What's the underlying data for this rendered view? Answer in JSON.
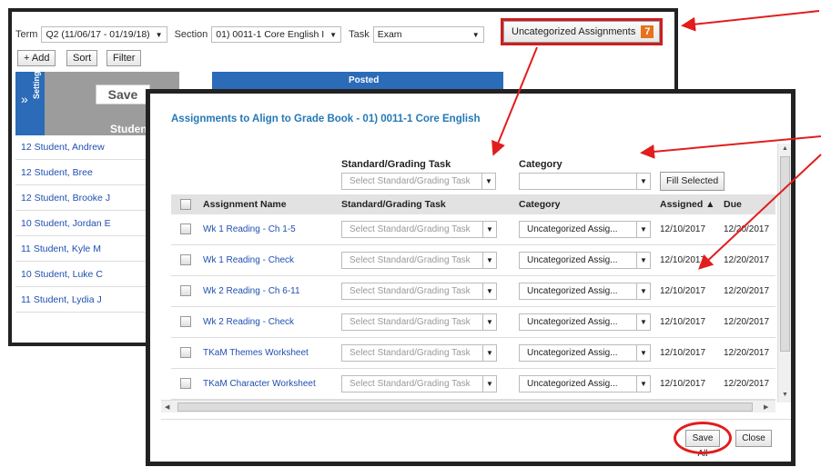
{
  "colors": {
    "accent_blue": "#2b6bb8",
    "link_blue": "#1f4fb0",
    "title_blue": "#2479b5",
    "annotation_red": "#e21d1d",
    "badge_orange": "#e8711a"
  },
  "filters": {
    "term_label": "Term",
    "term_value": "Q2 (11/06/17 - 01/19/18)",
    "section_label": "Section",
    "section_value": "01) 0011-1 Core English I",
    "task_label": "Task",
    "task_value": "Exam",
    "uncategorized_label": "Uncategorized Assignments",
    "uncategorized_count": "7"
  },
  "toolbar": {
    "add_label": "+ Add",
    "sort_label": "Sort",
    "filter_label": "Filter"
  },
  "gradebook": {
    "settings_label": "Settings",
    "save_label": "Save",
    "students_label": "Students",
    "posted_label": "Posted",
    "students": [
      "12 Student, Andrew",
      "12 Student, Bree",
      "12 Student, Brooke J",
      "10 Student, Jordan E",
      "11 Student, Kyle M",
      "10 Student, Luke C",
      "11 Student, Lydia J"
    ]
  },
  "modal": {
    "title": "Assignments to Align to Grade Book - 01) 0011-1 Core English",
    "fill_standard_label": "Standard/Grading Task",
    "fill_standard_placeholder": "Select Standard/Grading Task",
    "fill_category_label": "Category",
    "fill_selected_label": "Fill Selected",
    "columns": {
      "name": "Assignment Name",
      "standard": "Standard/Grading Task",
      "category": "Category",
      "assigned": "Assigned ▲",
      "due": "Due"
    },
    "rows": [
      {
        "name": "Wk 1 Reading - Ch 1-5",
        "standard": "Select Standard/Grading Task",
        "category": "Uncategorized Assig...",
        "assigned": "12/10/2017",
        "due": "12/20/2017"
      },
      {
        "name": "Wk 1 Reading - Check",
        "standard": "Select Standard/Grading Task",
        "category": "Uncategorized Assig...",
        "assigned": "12/10/2017",
        "due": "12/20/2017"
      },
      {
        "name": "Wk 2 Reading - Ch 6-11",
        "standard": "Select Standard/Grading Task",
        "category": "Uncategorized Assig...",
        "assigned": "12/10/2017",
        "due": "12/20/2017"
      },
      {
        "name": "Wk 2 Reading - Check",
        "standard": "Select Standard/Grading Task",
        "category": "Uncategorized Assig...",
        "assigned": "12/10/2017",
        "due": "12/20/2017"
      },
      {
        "name": "TKaM Themes Worksheet",
        "standard": "Select Standard/Grading Task",
        "category": "Uncategorized Assig...",
        "assigned": "12/10/2017",
        "due": "12/20/2017"
      },
      {
        "name": "TKaM Character Worksheet",
        "standard": "Select Standard/Grading Task",
        "category": "Uncategorized Assig...",
        "assigned": "12/10/2017",
        "due": "12/20/2017"
      }
    ],
    "save_all_label": "Save All",
    "close_label": "Close"
  }
}
